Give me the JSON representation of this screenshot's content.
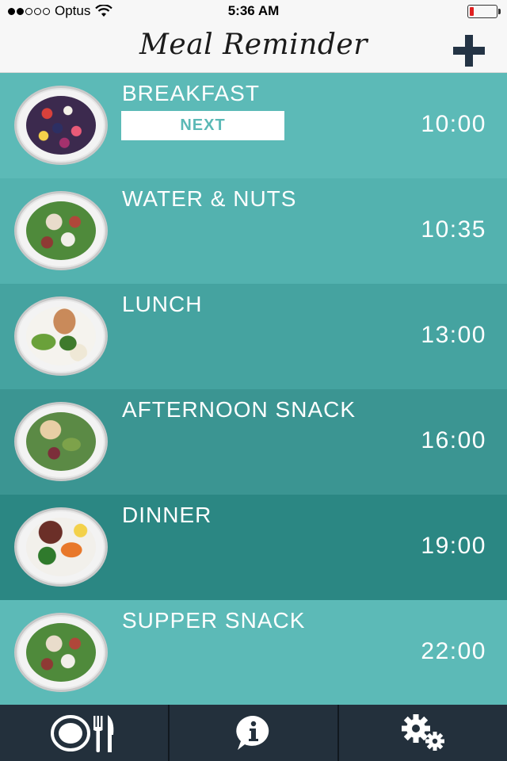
{
  "status_bar": {
    "carrier": "Optus",
    "time": "5:36 AM",
    "signal_bars": 2,
    "signal_total": 5,
    "battery_level": 0.15,
    "battery_color": "#e02020",
    "wifi_icon": "wifi-icon"
  },
  "nav": {
    "title": "Meal Reminder",
    "add_icon": "plus-icon"
  },
  "meals": [
    {
      "name": "BREAKFAST",
      "time": "10:00",
      "badge": "NEXT",
      "color": "#5cbab7",
      "food": "berries"
    },
    {
      "name": "WATER & NUTS",
      "time": "10:35",
      "color": "#53b2af",
      "food": "salad"
    },
    {
      "name": "LUNCH",
      "time": "13:00",
      "color": "#45a3a0",
      "food": "salmon"
    },
    {
      "name": "AFTERNOON SNACK",
      "time": "16:00",
      "color": "#3b9592",
      "food": "chicken"
    },
    {
      "name": "DINNER",
      "time": "19:00",
      "color": "#2b8783",
      "food": "steak"
    },
    {
      "name": "SUPPER SNACK",
      "time": "22:00",
      "color": "#5cbab7",
      "food": "salad"
    }
  ],
  "tab_bar": {
    "background": "#23303c",
    "tabs": [
      "plate-cutlery-icon",
      "info-icon",
      "gears-icon"
    ]
  }
}
